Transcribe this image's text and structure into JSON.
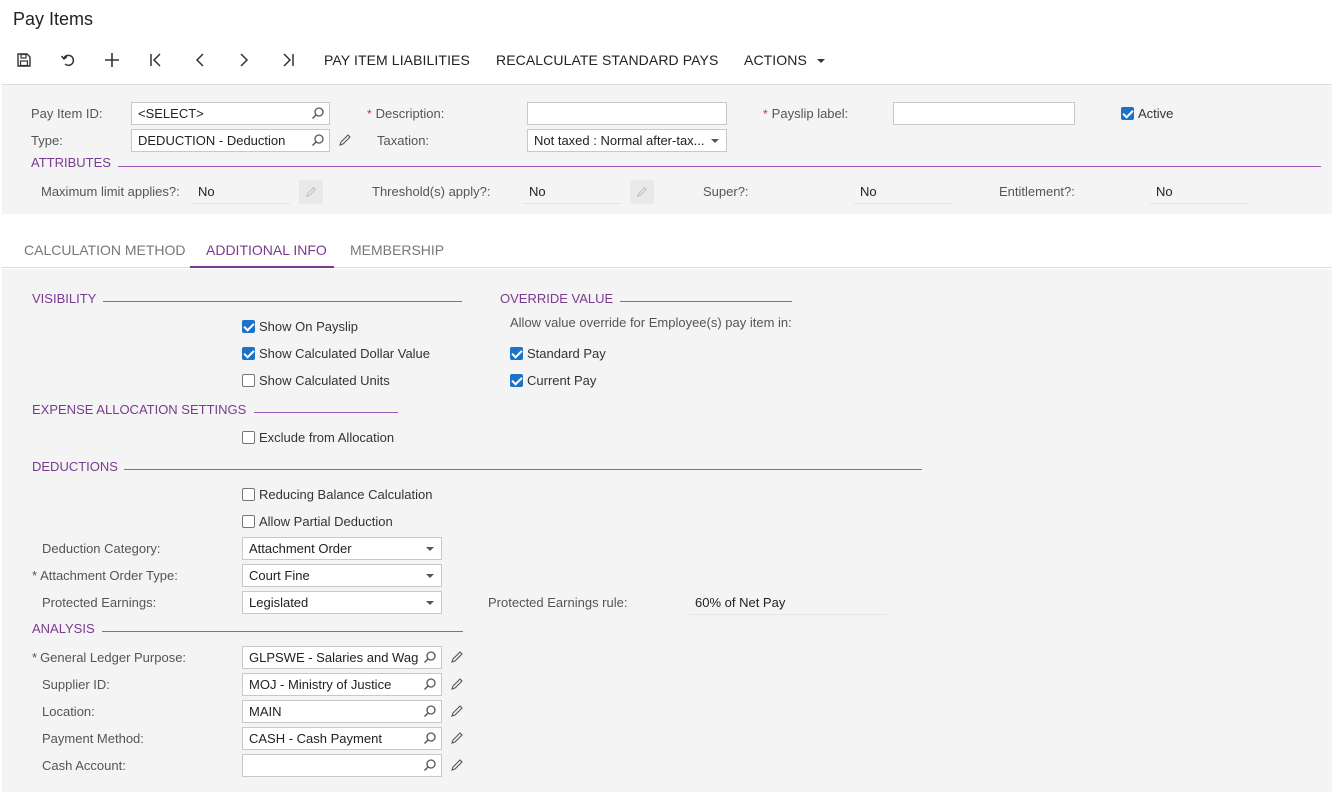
{
  "page_title": "Pay Items",
  "toolbar": {
    "pay_item_liabilities": "PAY ITEM LIABILITIES",
    "recalculate": "RECALCULATE STANDARD PAYS",
    "actions": "ACTIONS"
  },
  "header": {
    "pay_item_id_label": "Pay Item ID:",
    "pay_item_id_value": "<SELECT>",
    "type_label": "Type:",
    "type_value": "DEDUCTION - Deduction",
    "description_label": "Description:",
    "description_value": "",
    "taxation_label": "Taxation:",
    "taxation_value": "Not taxed : Normal after-tax...",
    "payslip_label_label": "Payslip label:",
    "payslip_label_value": "",
    "active_label": "Active",
    "active_checked": true
  },
  "attributes": {
    "title": "ATTRIBUTES",
    "max_limit_label": "Maximum limit applies?:",
    "max_limit_value": "No",
    "threshold_label": "Threshold(s) apply?:",
    "threshold_value": "No",
    "super_label": "Super?:",
    "super_value": "No",
    "entitlement_label": "Entitlement?:",
    "entitlement_value": "No"
  },
  "tabs": [
    {
      "label": "CALCULATION METHOD",
      "active": false
    },
    {
      "label": "ADDITIONAL INFO",
      "active": true
    },
    {
      "label": "MEMBERSHIP",
      "active": false
    }
  ],
  "visibility": {
    "title": "VISIBILITY",
    "show_on_payslip": "Show On Payslip",
    "show_calc_dollar": "Show Calculated Dollar Value",
    "show_calc_units": "Show Calculated Units"
  },
  "override": {
    "title": "OVERRIDE VALUE",
    "desc": "Allow value override for Employee(s) pay item in:",
    "standard_pay": "Standard Pay",
    "current_pay": "Current Pay"
  },
  "expense": {
    "title": "EXPENSE ALLOCATION SETTINGS",
    "exclude": "Exclude from Allocation"
  },
  "deductions": {
    "title": "DEDUCTIONS",
    "reducing_balance": "Reducing Balance Calculation",
    "allow_partial": "Allow Partial Deduction",
    "category_label": "Deduction Category:",
    "category_value": "Attachment Order",
    "attachment_type_label": "Attachment Order Type:",
    "attachment_type_value": "Court Fine",
    "protected_label": "Protected Earnings:",
    "protected_value": "Legislated",
    "protected_rule_label": "Protected Earnings rule:",
    "protected_rule_value": "60% of Net Pay"
  },
  "analysis": {
    "title": "ANALYSIS",
    "gl_purpose_label": "General Ledger Purpose:",
    "gl_purpose_value": "GLPSWE - Salaries and Wag",
    "supplier_label": "Supplier ID:",
    "supplier_value": "MOJ - Ministry of Justice",
    "location_label": "Location:",
    "location_value": "MAIN",
    "payment_method_label": "Payment Method:",
    "payment_method_value": "CASH - Cash Payment",
    "cash_account_label": "Cash Account:",
    "cash_account_value": ""
  },
  "colors": {
    "accent": "#7a3b8f",
    "checkbox": "#1a73c8",
    "required": "#c9302c"
  }
}
